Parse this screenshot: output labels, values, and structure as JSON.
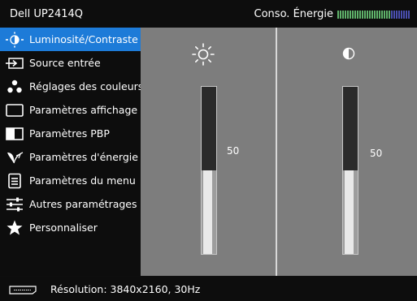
{
  "header": {
    "model": "Dell UP2414Q",
    "energy_label": "Conso. Énergie",
    "energy_level": 0.72
  },
  "sidebar": {
    "items": [
      {
        "label": "Luminosité/Contraste",
        "icon": "brightness-contrast-icon",
        "selected": true
      },
      {
        "label": "Source entrée",
        "icon": "input-source-icon"
      },
      {
        "label": "Réglages des couleurs",
        "icon": "color-settings-icon"
      },
      {
        "label": "Paramètres affichage",
        "icon": "display-settings-icon"
      },
      {
        "label": "Paramètres PBP",
        "icon": "pbp-icon"
      },
      {
        "label": "Paramètres d'énergie",
        "icon": "energy-settings-icon"
      },
      {
        "label": "Paramètres du menu",
        "icon": "menu-settings-icon"
      },
      {
        "label": "Autres paramétrages",
        "icon": "other-settings-icon"
      },
      {
        "label": "Personnaliser",
        "icon": "star-icon"
      }
    ]
  },
  "brightness": {
    "icon": "sun-icon",
    "value": "50",
    "level": 0.5
  },
  "contrast": {
    "icon": "contrast-icon",
    "value": "50",
    "level": 0.5
  },
  "footer": {
    "port_icon": "displayport-icon",
    "resolution": "Résolution: 3840x2160, 30Hz"
  },
  "colors": {
    "selected": "#1d7bd8",
    "panel": "#7d7d7d",
    "background": "#0d0d0d"
  }
}
